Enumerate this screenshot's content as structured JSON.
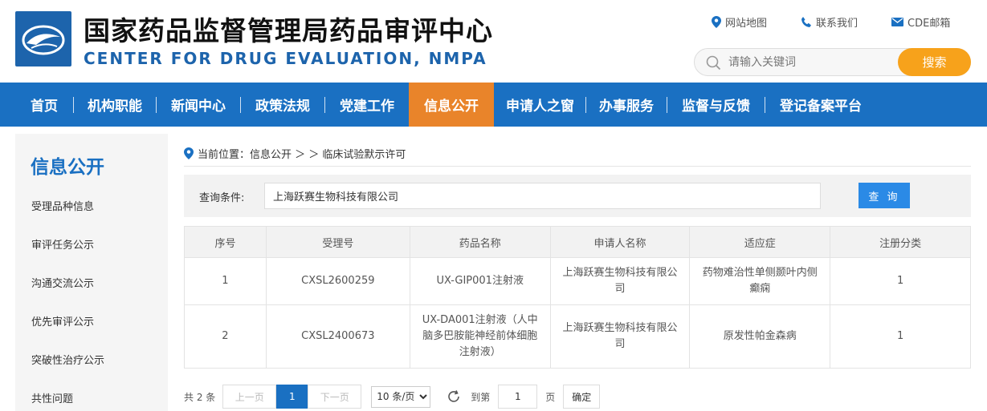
{
  "header": {
    "title_cn": "国家药品监督管理局药品审评中心",
    "title_en": "CENTER FOR DRUG EVALUATION, NMPA",
    "links": [
      "网站地图",
      "联系我们",
      "CDE邮箱"
    ],
    "search_placeholder": "请输入关键词",
    "search_button": "搜索"
  },
  "nav": {
    "items": [
      "首页",
      "机构职能",
      "新闻中心",
      "政策法规",
      "党建工作",
      "信息公开",
      "申请人之窗",
      "办事服务",
      "监督与反馈",
      "登记备案平台"
    ],
    "active": "信息公开"
  },
  "sidebar": {
    "title": "信息公开",
    "items": [
      "受理品种信息",
      "审评任务公示",
      "沟通交流公示",
      "优先审评公示",
      "突破性治疗公示",
      "共性问题"
    ]
  },
  "breadcrumb": "当前位置：信息公开 ＞ ＞ 临床试验默示许可",
  "query": {
    "label": "查询条件:",
    "value": "上海跃赛生物科技有限公司",
    "button": "查 询"
  },
  "table": {
    "headers": [
      "序号",
      "受理号",
      "药品名称",
      "申请人名称",
      "适应症",
      "注册分类"
    ],
    "rows": [
      [
        "1",
        "CXSL2600259",
        "UX-GIP001注射液",
        "上海跃赛生物科技有限公司",
        "药物难治性单侧颞叶内侧癫痫",
        "1"
      ],
      [
        "2",
        "CXSL2400673",
        "UX-DA001注射液（人中脑多巴胺能神经前体细胞注射液）",
        "上海跃赛生物科技有限公司",
        "原发性帕金森病",
        "1"
      ]
    ]
  },
  "pager": {
    "total": "共 2 条",
    "prev": "上一页",
    "current": "1",
    "next": "下一页",
    "page_size": "10 条/页",
    "goto": "到第",
    "goto_value": "1",
    "page_unit": "页",
    "confirm": "确定"
  },
  "colors": {
    "brand_blue": "#1a70c2",
    "active_orange": "#e9842a",
    "search_orange": "#f7a21b"
  }
}
